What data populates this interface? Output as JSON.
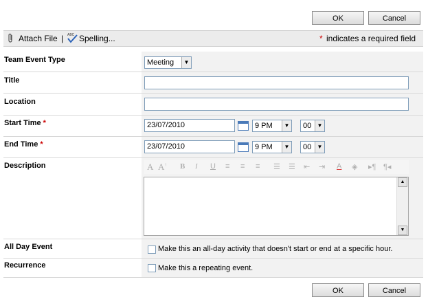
{
  "buttons": {
    "ok": "OK",
    "cancel": "Cancel"
  },
  "toolbar": {
    "attach_file": "Attach File",
    "separator": "|",
    "spelling": "Spelling...",
    "required_asterisk": "*",
    "required_note": "indicates a required field"
  },
  "form": {
    "team_event_type": {
      "label": "Team Event Type",
      "value": "Meeting"
    },
    "title": {
      "label": "Title",
      "value": ""
    },
    "location": {
      "label": "Location",
      "value": ""
    },
    "start_time": {
      "label": "Start Time",
      "required": "*",
      "date": "23/07/2010",
      "hour": "9 PM",
      "minute": "00"
    },
    "end_time": {
      "label": "End Time",
      "required": "*",
      "date": "23/07/2010",
      "hour": "9 PM",
      "minute": "00"
    },
    "description": {
      "label": "Description",
      "value": ""
    },
    "all_day_event": {
      "label": "All Day Event",
      "checkbox_text": "Make this an all-day activity that doesn't start or end at a specific hour."
    },
    "recurrence": {
      "label": "Recurrence",
      "checkbox_text": "Make this a repeating event."
    }
  },
  "icons": [
    "paperclip-icon",
    "spelling-icon",
    "calendar-icon"
  ]
}
